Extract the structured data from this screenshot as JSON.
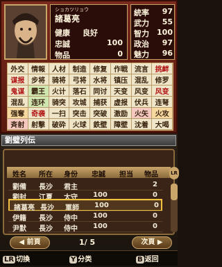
{
  "officer": {
    "furigana": "ショカツリョウ",
    "name": "諸葛亮",
    "status_label": "健康",
    "status_value": "良好",
    "loyalty_label": "忠誠",
    "loyalty_value": "100",
    "items_label": "物品",
    "items_value": "0"
  },
  "stats": [
    {
      "label": "統率",
      "value": "97"
    },
    {
      "label": "武力",
      "value": "55"
    },
    {
      "label": "智力",
      "value": "100"
    },
    {
      "label": "政治",
      "value": "97"
    },
    {
      "label": "魅力",
      "value": "96"
    }
  ],
  "skills": [
    [
      "外交",
      "情報",
      "人材",
      "制造",
      "修复",
      "作戦",
      "流言",
      "挑衅"
    ],
    [
      "谋报",
      "步将",
      "骑将",
      "弓将",
      "水将",
      "镇压",
      "混乱",
      "修罗"
    ],
    [
      "鬼谋",
      "霸王",
      "火计",
      "落石",
      "同讨",
      "天变",
      "风变",
      "风变"
    ],
    [
      "混乱",
      "连环",
      "骑突",
      "攻城",
      "捕获",
      "虚报",
      "伏兵",
      "连弩"
    ],
    [
      "强奪",
      "奇袭",
      "一扫",
      "突击",
      "突破",
      "激励",
      "火矢",
      "火攻"
    ],
    [
      "斉射",
      "射撃",
      "破砕",
      "火球",
      "鉄壁",
      "障壁",
      "沈着",
      "大喝"
    ]
  ],
  "list": {
    "title": "劉璧列伝",
    "headers": [
      "姓名",
      "所在",
      "身份",
      "忠誠",
      "担当",
      "物品"
    ],
    "rows": [
      {
        "name": "劉備",
        "loc": "長沙",
        "rank": "君主",
        "loyalty": "",
        "duty": "",
        "items": "2"
      },
      {
        "name": "劉封",
        "loc": "江夏",
        "rank": "太守",
        "loyalty": "100",
        "duty": "",
        "items": "0"
      },
      {
        "name": "諸葛亮",
        "loc": "長沙",
        "rank": "軍師",
        "loyalty": "100",
        "duty": "",
        "items": "0"
      },
      {
        "name": "伊籍",
        "loc": "長沙",
        "rank": "侍中",
        "loyalty": "100",
        "duty": "",
        "items": "0"
      },
      {
        "name": "尹默",
        "loc": "長沙",
        "rank": "侍中",
        "loyalty": "100",
        "duty": "",
        "items": "0"
      }
    ],
    "lr_label": "LR",
    "prev_label": "前頁",
    "next_label": "次頁",
    "page_current": "1",
    "page_total": "5",
    "page_text": "1/ 5"
  },
  "footer": {
    "lr_key": "LR",
    "lr_label": "切換",
    "y_key": "Y",
    "y_label": "分类",
    "b_key": "B",
    "b_label": "返回"
  },
  "colors": {
    "accent": "#c9a56a",
    "frame": "#7a2a1c",
    "selected": "#f0c040"
  }
}
